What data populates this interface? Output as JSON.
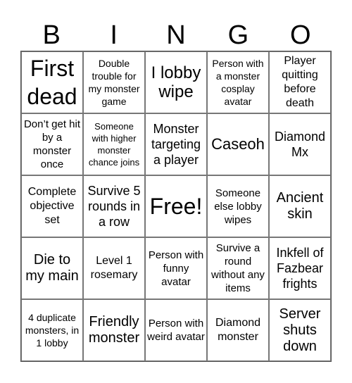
{
  "header": [
    "B",
    "I",
    "N",
    "G",
    "O"
  ],
  "cells": [
    [
      "First dead",
      "Double trouble for my monster game",
      "I lobby wipe",
      "Person with a monster cosplay avatar",
      "Player quitting before death"
    ],
    [
      "Don’t get hit by a monster once",
      "Someone with higher monster chance joins",
      "Monster targeting a player",
      "Caseoh",
      "Diamond Mx"
    ],
    [
      "Complete objective set",
      "Survive 5 rounds in a row",
      "Free!",
      "Someone else lobby wipes",
      "Ancient skin"
    ],
    [
      "Die to my main",
      "Level 1 rosemary",
      "Person with funny avatar",
      "Survive a round without any items",
      "Inkfell of Fazbear frights"
    ],
    [
      "4 duplicate monsters, in 1 lobby",
      "Friendly monster",
      "Person with weird avatar",
      "Diamond monster",
      "Server shuts down"
    ]
  ]
}
